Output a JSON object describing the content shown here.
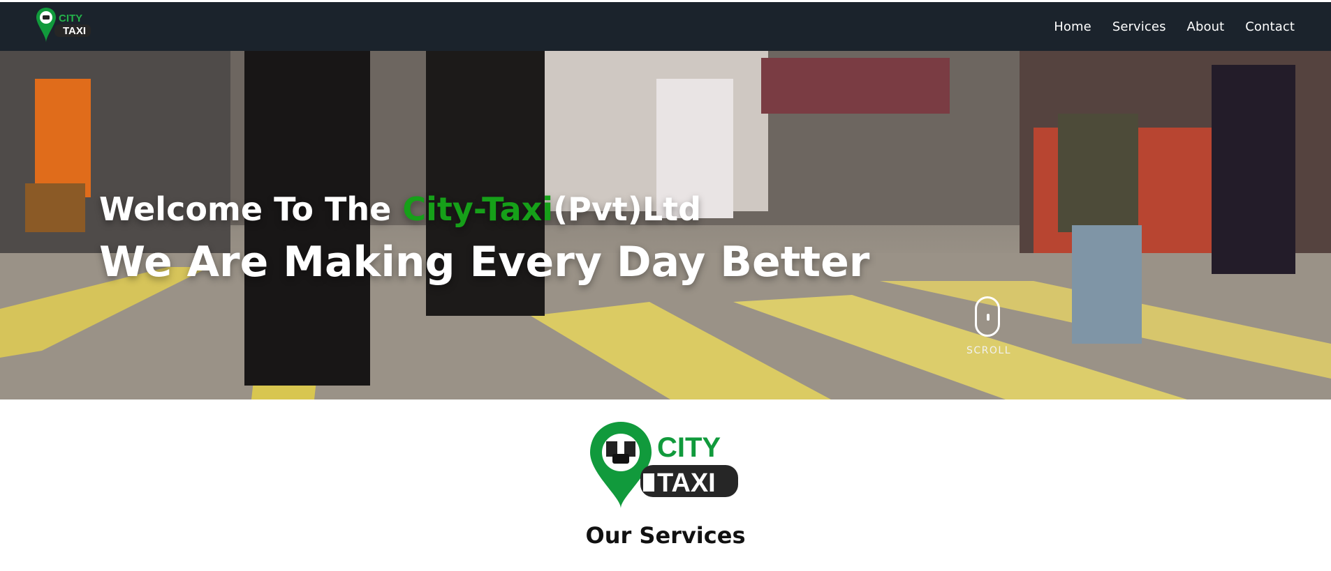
{
  "navbar": {
    "logo": {
      "top": "CITY",
      "bottom": "TAXI"
    },
    "links": [
      "Home",
      "Services",
      "About",
      "Contact"
    ]
  },
  "hero": {
    "welcome_prefix": "Welcome To The ",
    "welcome_brand": "City-Taxi",
    "welcome_suffix": "(Pvt)Ltd",
    "tagline": "We Are Making Every Day Better",
    "scroll_label": "SCROLL"
  },
  "services": {
    "logo": {
      "top": "CITY",
      "bottom": "TAXI"
    },
    "title": "Our Services"
  },
  "colors": {
    "navbar_bg": "#1b232c",
    "brand_green": "#16a019",
    "logo_green": "#119a3c",
    "text_dark": "#111111"
  },
  "icons": [
    "location-pin-icon",
    "mouse-scroll-icon"
  ]
}
